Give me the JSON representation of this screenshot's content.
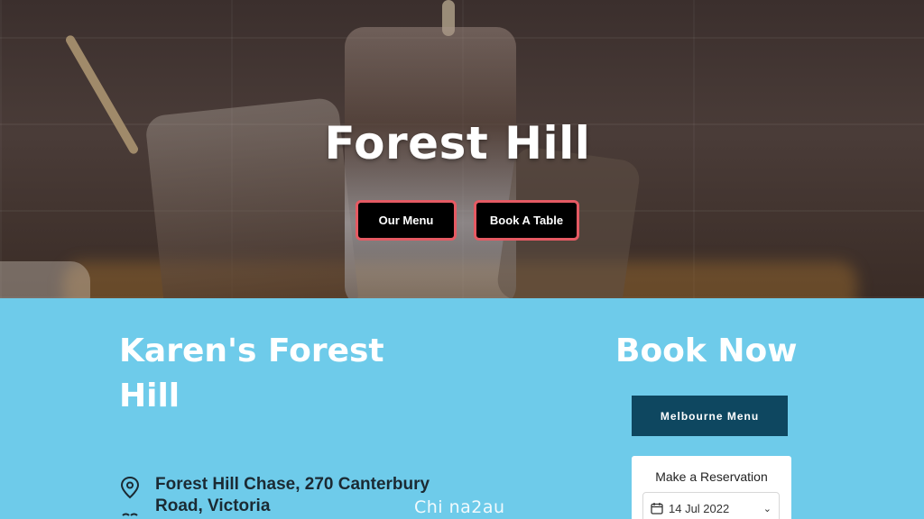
{
  "hero": {
    "title": "Forest Hill",
    "buttons": [
      {
        "label": "Our Menu"
      },
      {
        "label": "Book A Table"
      }
    ]
  },
  "location": {
    "heading": "Karen's Forest Hill",
    "address": "Forest Hill Chase, 270 Canterbury Road, Victoria",
    "address_icon": "map-pin-icon",
    "phone_icon": "phone-icon"
  },
  "booking": {
    "heading": "Book Now",
    "menu_button": "Melbourne Menu",
    "reservation_title": "Make a Reservation",
    "date_value": "14 Jul 2022"
  },
  "watermark": "Chi na2au",
  "colors": {
    "accent_border": "#e55a63",
    "section_bg": "#6ecbea",
    "menu_button_bg": "#0e4760"
  }
}
